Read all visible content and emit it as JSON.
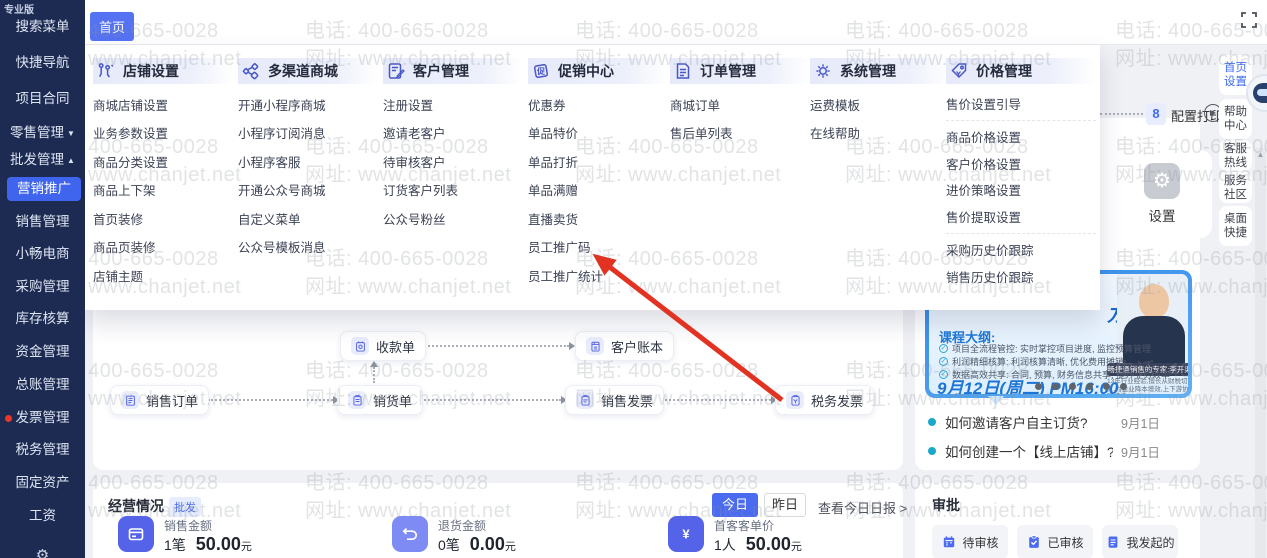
{
  "app": {
    "edition": "专业版"
  },
  "watermark": {
    "phone": "电话: 400-665-0028",
    "site": "网址: www.chanjet.net"
  },
  "topbar": {
    "tab": "首页"
  },
  "sidebar": {
    "items": [
      {
        "label": "搜索菜单"
      },
      {
        "label": "快捷导航"
      },
      {
        "label": "项目合同"
      },
      {
        "label": "零售管理",
        "arrow": "▼"
      },
      {
        "label": "批发管理",
        "arrow": "▲"
      },
      {
        "label": "营销推广",
        "active": true,
        "sub": true
      },
      {
        "label": "销售管理",
        "sub": true
      },
      {
        "label": "小畅电商"
      },
      {
        "label": "采购管理"
      },
      {
        "label": "库存核算"
      },
      {
        "label": "资金管理"
      },
      {
        "label": "总账管理"
      },
      {
        "label": "发票管理",
        "dot": true
      },
      {
        "label": "税务管理"
      },
      {
        "label": "固定资产"
      },
      {
        "label": "工资"
      }
    ]
  },
  "megamenu": {
    "columns": [
      {
        "title": "店铺设置",
        "icon": "shop-settings-icon",
        "items": [
          "商城店铺设置",
          "业务参数设置",
          "商品分类设置",
          "商品上下架",
          "首页装修",
          "商品页装修",
          "店铺主题"
        ]
      },
      {
        "title": "多渠道商城",
        "icon": "multi-channel-icon",
        "items": [
          "开通小程序商城",
          "小程序订阅消息",
          "小程序客服",
          "开通公众号商城",
          "自定义菜单",
          "公众号模板消息"
        ]
      },
      {
        "title": "客户管理",
        "icon": "customer-management-icon",
        "items": [
          "注册设置",
          "邀请老客户",
          "待审核客户",
          "订货客户列表",
          "公众号粉丝"
        ]
      },
      {
        "title": "促销中心",
        "icon": "promotion-center-icon",
        "items": [
          "优惠券",
          "单品特价",
          "单品打折",
          "单品满赠",
          "直播卖货",
          "员工推广码",
          "员工推广统计"
        ]
      },
      {
        "title": "订单管理",
        "icon": "order-management-icon",
        "items": [
          "商城订单",
          "售后单列表"
        ]
      },
      {
        "title": "系统管理",
        "icon": "system-management-icon",
        "items": [
          "运费模板",
          "在线帮助"
        ]
      },
      {
        "title": "价格管理",
        "icon": "price-management-icon",
        "items": [
          "售价设置引导",
          "|",
          "商品价格设置",
          "客户价格设置",
          "进价策略设置",
          "售价提取设置",
          "|",
          "采购历史价跟踪",
          "销售历史价跟踪"
        ]
      }
    ]
  },
  "flow": {
    "boxes": [
      {
        "label": "收款单",
        "icon": "receipt-icon"
      },
      {
        "label": "客户账本",
        "icon": "ledger-icon"
      },
      {
        "label": "销售订单",
        "icon": "sales-order-icon"
      },
      {
        "label": "销货单",
        "icon": "delivery-doc-icon"
      },
      {
        "label": "销售发票",
        "icon": "sales-invoice-icon"
      },
      {
        "label": "税务发票",
        "icon": "tax-invoice-icon"
      }
    ]
  },
  "print_step": {
    "badge": "8",
    "label": "配置打印"
  },
  "settings_tile": {
    "label": "设置"
  },
  "right_rail": {
    "items": [
      {
        "line1": "首页",
        "line2": "设置",
        "active": true
      },
      {
        "line1": "帮助",
        "line2": "中心"
      },
      {
        "line1": "客服",
        "line2": "热线"
      },
      {
        "line1": "服务",
        "line2": "社区"
      },
      {
        "line1": "桌面",
        "line2": "快捷"
      }
    ]
  },
  "banner": {
    "title_visible": "方案",
    "outline_title": "课程大纲:",
    "bullets": [
      "项目全流程管控: 实时掌控项目进度, 监控预算管理",
      "利润精细核算: 利润核算清晰, 优化费用摊销",
      "数据高效共享: 合同, 预算, 财务信息共享, 提升业务效率"
    ],
    "datetime": "9月12日(周二) PM16:00",
    "expert": "畅捷通销售的专家:李开渠",
    "expert_desc": "13年行业经验,擅长从财税切入,为企业降本增效,上下游协同打法"
  },
  "news": [
    {
      "title": "如何邀请客户自主订货?",
      "date": "9月1日"
    },
    {
      "title": "如何创建一个【线上店铺】?",
      "date": "9月1日"
    }
  ],
  "approval": {
    "title": "审批",
    "buttons": [
      {
        "label": "待审核",
        "icon": "calendar-icon"
      },
      {
        "label": "已审核",
        "icon": "clipboard-check-icon"
      },
      {
        "label": "我发起的",
        "icon": "document-icon"
      }
    ]
  },
  "business": {
    "title": "经营情况",
    "badge": "批发",
    "today": "今日",
    "yesterday": "昨日",
    "report_link": "查看今日日报 >",
    "stats": [
      {
        "label": "销售金额",
        "count": "1笔",
        "value": "50.00",
        "unit": "元",
        "icon": "sales-amount-icon",
        "color": "#5463e8"
      },
      {
        "label": "退货金额",
        "count": "0笔",
        "value": "0.00",
        "unit": "元",
        "icon": "refund-amount-icon",
        "color": "#7e8bf5"
      },
      {
        "label": "首客客单价",
        "count": "1人",
        "value": "50.00",
        "unit": "元",
        "icon": "customer-price-icon",
        "color": "#5463e8"
      }
    ]
  },
  "colors": {
    "accent": "#3f65ef",
    "sidebar": "#1d2b52",
    "arrow": "#e23222",
    "watermark_tone": "#9aa0ab"
  }
}
